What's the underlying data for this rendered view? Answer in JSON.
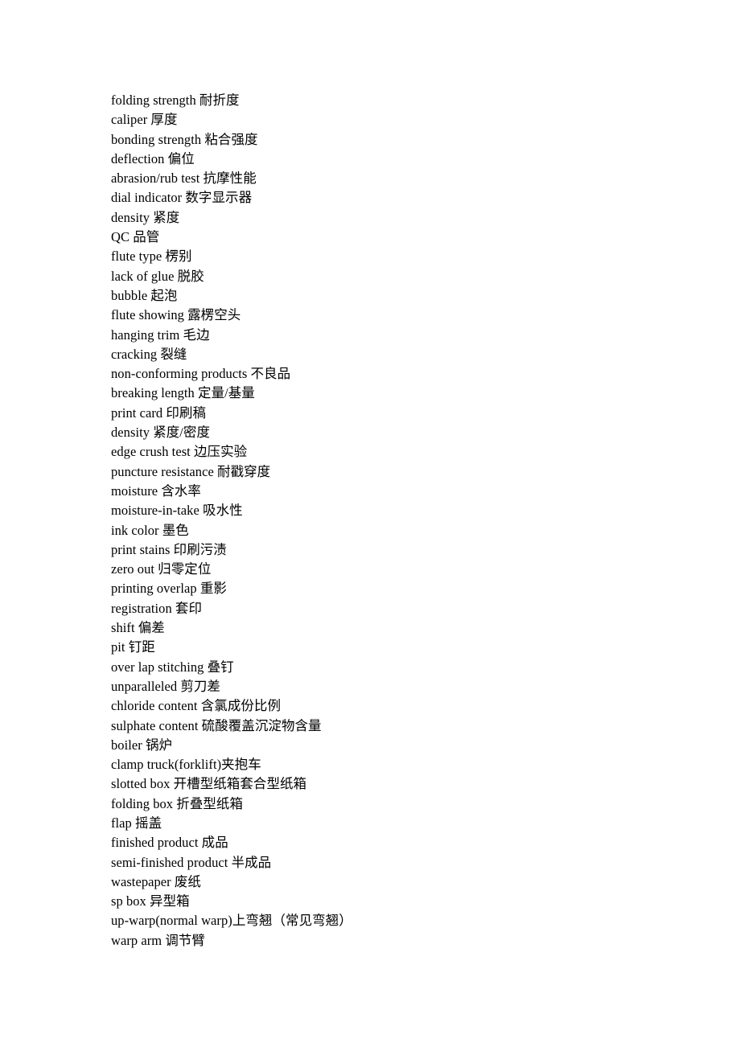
{
  "document": {
    "type": "glossary",
    "language_pair": "English-Chinese",
    "entry_count": 44,
    "entries": [
      {
        "text": "folding strength 耐折度"
      },
      {
        "text": "caliper 厚度"
      },
      {
        "text": "bonding strength 粘合强度"
      },
      {
        "text": "deflection 偏位"
      },
      {
        "text": "abrasion/rub test 抗摩性能"
      },
      {
        "text": "dial indicator 数字显示器"
      },
      {
        "text": "density 紧度"
      },
      {
        "text": "QC 品管"
      },
      {
        "text": "flute type 楞别"
      },
      {
        "text": "lack of glue 脱胶"
      },
      {
        "text": "bubble 起泡"
      },
      {
        "text": "flute showing 露楞空头"
      },
      {
        "text": "hanging trim 毛边"
      },
      {
        "text": "cracking 裂缝"
      },
      {
        "text": "non-conforming products 不良品"
      },
      {
        "text": "breaking length 定量/基量"
      },
      {
        "text": "print card 印刷稿"
      },
      {
        "text": "density 紧度/密度"
      },
      {
        "text": "edge crush test 边压实验"
      },
      {
        "text": "puncture resistance 耐戳穿度"
      },
      {
        "text": "moisture 含水率"
      },
      {
        "text": "moisture-in-take 吸水性"
      },
      {
        "text": "ink color 墨色"
      },
      {
        "text": "print stains 印刷污渍"
      },
      {
        "text": "zero out 归零定位"
      },
      {
        "text": "printing overlap 重影"
      },
      {
        "text": "registration 套印"
      },
      {
        "text": "shift 偏差"
      },
      {
        "text": "pit 钉距"
      },
      {
        "text": "over lap stitching 叠钉"
      },
      {
        "text": "unparalleled 剪刀差"
      },
      {
        "text": "chloride content 含氯成份比例"
      },
      {
        "text": "sulphate content 硫酸覆盖沉淀物含量"
      },
      {
        "text": "boiler 锅炉"
      },
      {
        "text": "clamp truck(forklift)夹抱车"
      },
      {
        "text": "slotted box 开槽型纸箱套合型纸箱"
      },
      {
        "text": "folding box 折叠型纸箱"
      },
      {
        "text": "flap 摇盖"
      },
      {
        "text": "finished product 成品"
      },
      {
        "text": "semi-finished product 半成品"
      },
      {
        "text": "wastepaper 废纸"
      },
      {
        "text": "sp box 异型箱"
      },
      {
        "text": "up-warp(normal warp)上弯翘（常见弯翘）"
      },
      {
        "text": "warp arm 调节臂"
      }
    ]
  }
}
